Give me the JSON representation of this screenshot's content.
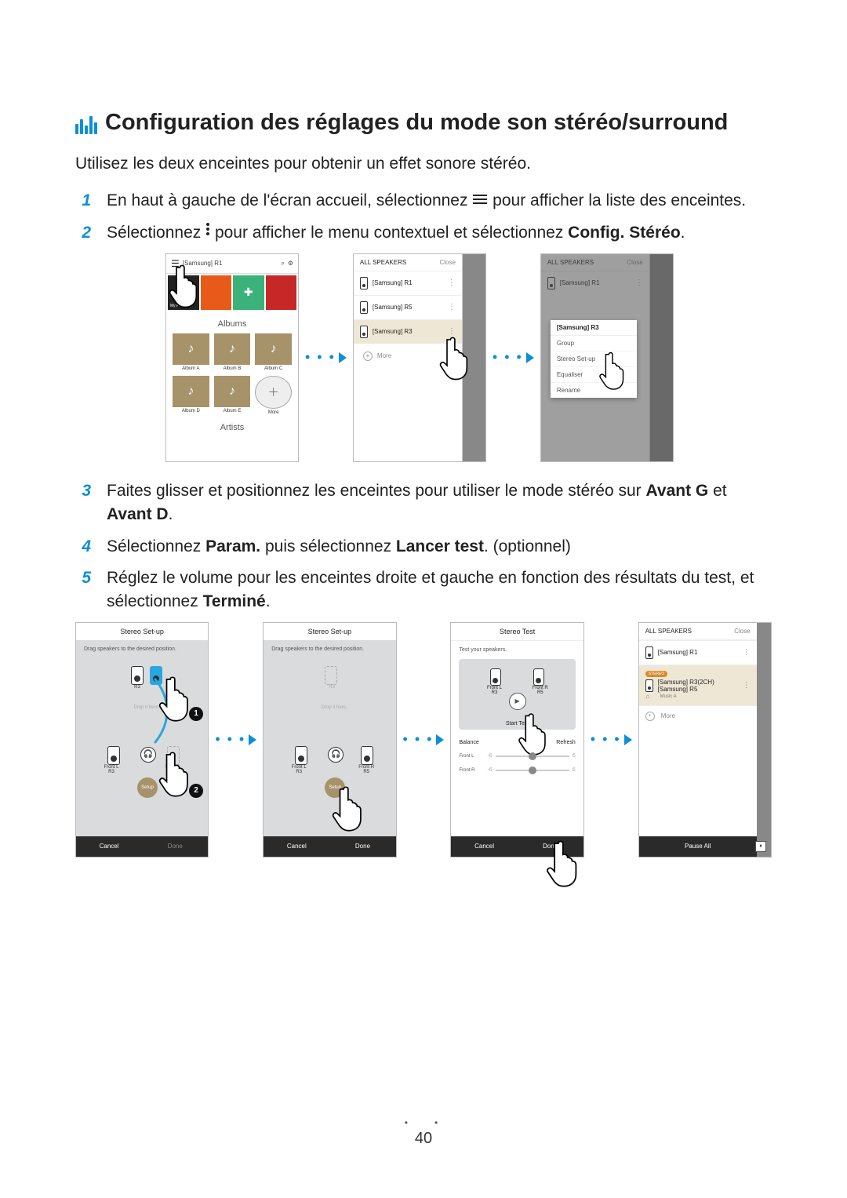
{
  "title": "Configuration des réglages du mode son stéréo/surround",
  "intro": "Utilisez les deux enceintes pour obtenir un effet sonore stéréo.",
  "steps": {
    "s1a": "En haut à gauche de l'écran accueil, sélectionnez ",
    "s1b": " pour afficher la liste des enceintes.",
    "s2a": "Sélectionnez ",
    "s2b": " pour afficher le menu contextuel et sélectionnez ",
    "s2bold": "Config. Stéréo",
    "s3a": "Faites glisser et positionnez les enceintes pour utiliser le mode stéréo sur ",
    "s3b1": "Avant G",
    "s3mid": " et ",
    "s3b2": "Avant D",
    "s4a": "Sélectionnez ",
    "s4b1": "Param.",
    "s4mid": " puis sélectionnez ",
    "s4b2": "Lancer test",
    "s4c": ". (optionnel)",
    "s5a": "Réglez le volume pour les enceintes droite et gauche en fonction des résultats du test, et sélectionnez ",
    "s5b": "Terminé"
  },
  "fig1": {
    "device": "[Samsung] R1",
    "my_phone": "My Phone",
    "sec_albums": "Albums",
    "sec_artists": "Artists",
    "albums": [
      "Album A",
      "Album B",
      "Album C",
      "Album D",
      "Album E"
    ],
    "more": "More",
    "panel_title": "ALL SPEAKERS",
    "close": "Close",
    "speakers": [
      "[Samsung] R1",
      "[Samsung] R5",
      "[Samsung] R3"
    ],
    "more2": "More",
    "popup_title": "[Samsung] R3",
    "popup_items": [
      "Group",
      "Stereo Set-up",
      "Equaliser",
      "Rename"
    ]
  },
  "fig2": {
    "setup_title": "Stereo Set-up",
    "drag_hint": "Drag speakers to the desired position.",
    "r3": "R3",
    "drop_hint": "Drop it here.",
    "front_l": "Front L",
    "front_r": "Front R",
    "r5": "R5",
    "setup_btn": "Setup",
    "cancel": "Cancel",
    "done": "Done",
    "test_title": "Stereo Test",
    "test_hint": "Test your speakers.",
    "start_test": "Start Test",
    "balance": "Balance",
    "refresh": "Refresh",
    "all_title": "ALL SPEAKERS",
    "r1": "[Samsung] R1",
    "stereo_tag": "STEREO",
    "combo1": "[Samsung] R3(2CH)",
    "combo2": "[Samsung] R5",
    "music": "Music A",
    "more": "More",
    "pause_all": "Pause All"
  },
  "page_number": "40"
}
